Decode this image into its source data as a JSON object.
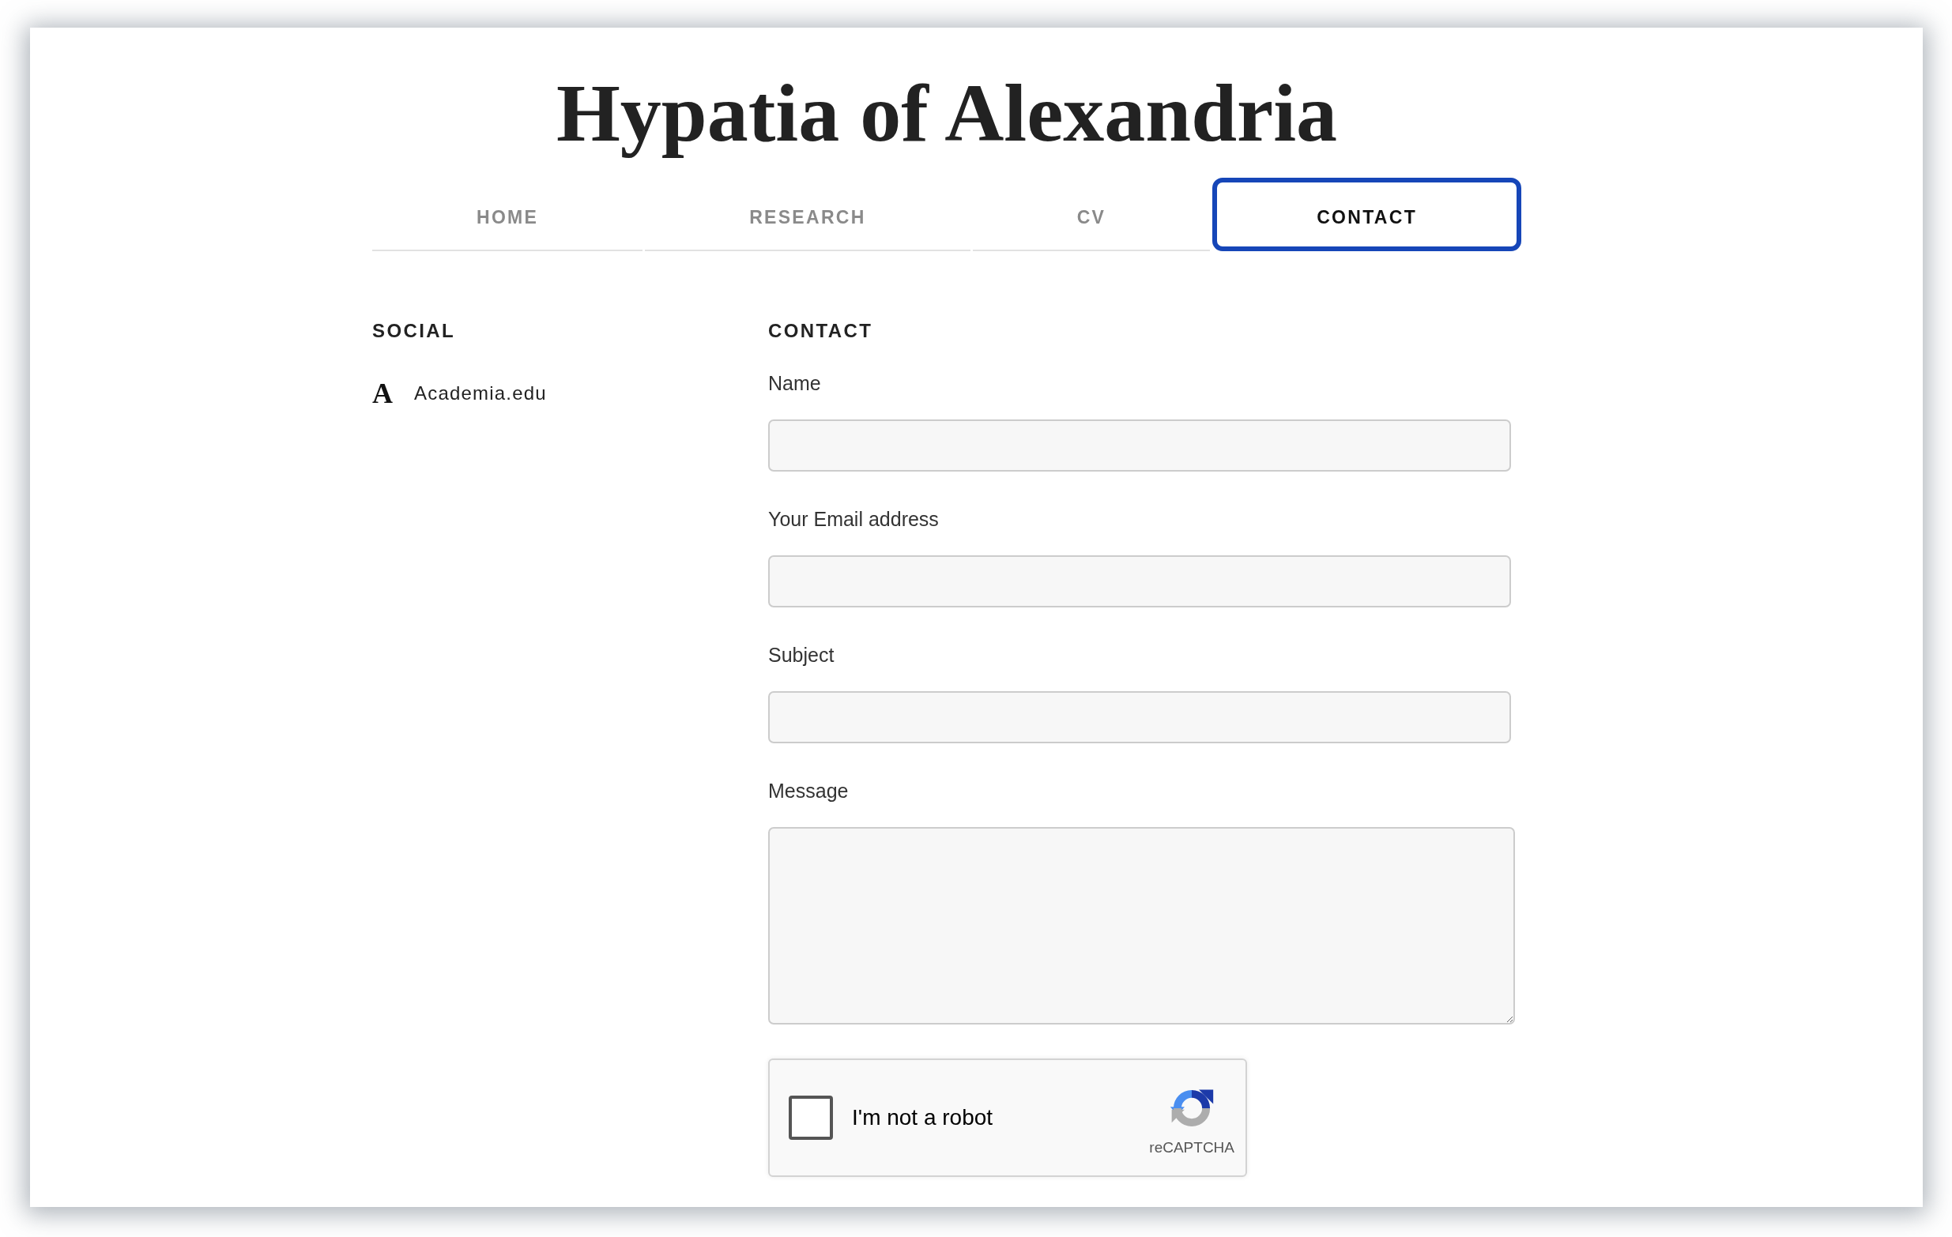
{
  "site_title": "Hypatia of Alexandria",
  "nav": [
    {
      "label": "HOME",
      "selected": false,
      "focused": false
    },
    {
      "label": "RESEARCH",
      "selected": false,
      "focused": false
    },
    {
      "label": "CV",
      "selected": false,
      "focused": false
    },
    {
      "label": "CONTACT",
      "selected": true,
      "focused": true
    }
  ],
  "social": {
    "heading": "SOCIAL",
    "links": [
      {
        "icon": "A",
        "label": "Academia.edu"
      }
    ]
  },
  "contact": {
    "heading": "CONTACT",
    "fields": [
      {
        "label": "Name",
        "kind": "input"
      },
      {
        "label": "Your Email address",
        "kind": "input"
      },
      {
        "label": "Subject",
        "kind": "input"
      },
      {
        "label": "Message",
        "kind": "textarea"
      }
    ],
    "captcha": {
      "label": "I'm not a robot",
      "checked": false,
      "brand": "reCAPTCHA"
    }
  }
}
